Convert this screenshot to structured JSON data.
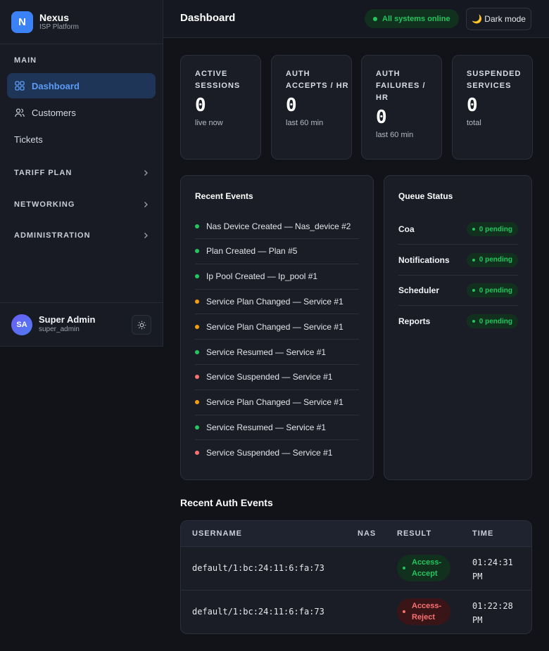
{
  "brand": {
    "initial": "N",
    "name": "Nexus",
    "subtitle": "ISP Platform"
  },
  "sidebar": {
    "section_label": "MAIN",
    "items": [
      {
        "label": "Dashboard",
        "icon": "grid-icon",
        "active": true
      },
      {
        "label": "Customers",
        "icon": "users-icon",
        "active": false
      },
      {
        "label": "Tickets",
        "icon": "",
        "active": false
      }
    ],
    "groups": [
      {
        "label": "TARIFF PLAN"
      },
      {
        "label": "NETWORKING"
      },
      {
        "label": "ADMINISTRATION"
      }
    ]
  },
  "user": {
    "initials": "SA",
    "name": "Super Admin",
    "handle": "super_admin"
  },
  "header": {
    "title": "Dashboard",
    "status": "All systems online",
    "mode_button": "🌙 Dark mode"
  },
  "stats": [
    {
      "label": "ACTIVE SESSIONS",
      "value": "0",
      "sub": "live now"
    },
    {
      "label": "AUTH ACCEPTS / HR",
      "value": "0",
      "sub": "last 60 min"
    },
    {
      "label": "AUTH FAILURES / HR",
      "value": "0",
      "sub": "last 60 min"
    },
    {
      "label": "SUSPENDED SERVICES",
      "value": "0",
      "sub": "total"
    }
  ],
  "recent_events": {
    "title": "Recent Events",
    "items": [
      {
        "text": "Nas Device Created — Nas_device #2",
        "color": "#22c55e"
      },
      {
        "text": "Plan Created — Plan #5",
        "color": "#22c55e"
      },
      {
        "text": "Ip Pool Created — Ip_pool #1",
        "color": "#22c55e"
      },
      {
        "text": "Service Plan Changed — Service #1",
        "color": "#f59e0b"
      },
      {
        "text": "Service Plan Changed — Service #1",
        "color": "#f59e0b"
      },
      {
        "text": "Service Resumed — Service #1",
        "color": "#22c55e"
      },
      {
        "text": "Service Suspended — Service #1",
        "color": "#f87171"
      },
      {
        "text": "Service Plan Changed — Service #1",
        "color": "#f59e0b"
      },
      {
        "text": "Service Resumed — Service #1",
        "color": "#22c55e"
      },
      {
        "text": "Service Suspended — Service #1",
        "color": "#f87171"
      }
    ]
  },
  "queue_status": {
    "title": "Queue Status",
    "items": [
      {
        "name": "Coa",
        "status": "0 pending"
      },
      {
        "name": "Notifications",
        "status": "0 pending"
      },
      {
        "name": "Scheduler",
        "status": "0 pending"
      },
      {
        "name": "Reports",
        "status": "0 pending"
      }
    ]
  },
  "auth_events": {
    "title": "Recent Auth Events",
    "columns": {
      "username": "USERNAME",
      "nas": "NAS",
      "result": "RESULT",
      "time": "TIME"
    },
    "rows": [
      {
        "username": "default/1:bc:24:11:6:fa:73",
        "nas": "",
        "result": "Access-Accept",
        "status": "ok",
        "time": "01:24:31 PM"
      },
      {
        "username": "default/1:bc:24:11:6:fa:73",
        "nas": "",
        "result": "Access-Reject",
        "status": "bad",
        "time": "01:22:28 PM"
      }
    ]
  }
}
